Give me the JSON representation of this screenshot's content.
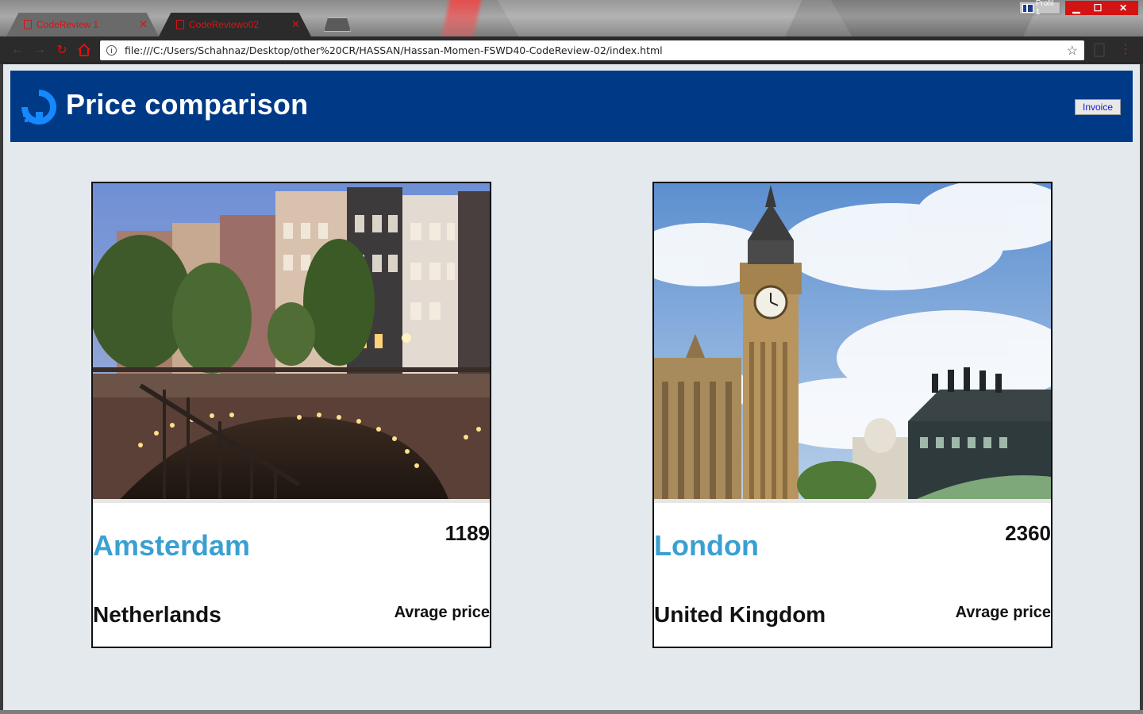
{
  "browser": {
    "tabs": [
      {
        "label": "CodeReview 1",
        "active": false
      },
      {
        "label": "CodeReviewo02",
        "active": true
      }
    ],
    "profile_label": "Profil 1",
    "address_url": "file:///C:/Users/Schahnaz/Desktop/other%20CR/HASSAN/Hassan-Momen-FSWD40-CodeReview-02/index.html",
    "accent_color": "#e01010"
  },
  "header": {
    "title": "Price comparison",
    "invoice_label": "Invoice",
    "background_color": "#003a86"
  },
  "cards": [
    {
      "city": "Amsterdam",
      "price": "1189",
      "country": "Netherlands",
      "price_label": "Avrage price"
    },
    {
      "city": "London",
      "price": "2360",
      "country": "United Kingdom",
      "price_label": "Avrage price"
    }
  ],
  "colors": {
    "city_name": "#3aa0d2",
    "page_background": "#e4e9ee"
  }
}
